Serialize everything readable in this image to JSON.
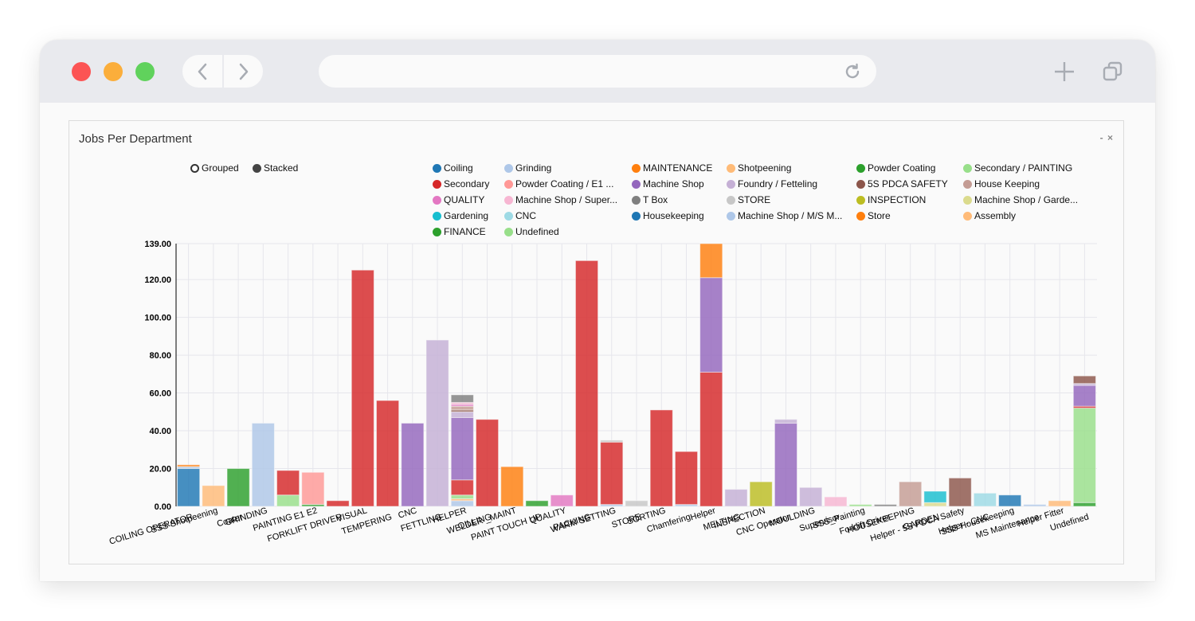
{
  "browser": {
    "url": ""
  },
  "panel": {
    "title": "Jobs Per Department",
    "minimize_label": "-",
    "close_label": "×"
  },
  "controls": {
    "grouped_label": "Grouped",
    "stacked_label": "Stacked",
    "selected": "Stacked"
  },
  "chart_data": {
    "type": "bar",
    "stacked": true,
    "title": "Jobs Per Department",
    "xlabel": "",
    "ylabel": "",
    "ylim": [
      0,
      139
    ],
    "yticks": [
      "0.00",
      "20.00",
      "40.00",
      "60.00",
      "80.00",
      "100.00",
      "120.00",
      "139.00"
    ],
    "ytick_values": [
      0,
      20,
      40,
      60,
      80,
      100,
      120,
      139
    ],
    "grid": true,
    "legend_position": "top-right",
    "categories": [
      "COILING OPERATOR",
      "SSS Shotpeening",
      "Coater",
      "GRINDING",
      "PAINTING",
      "E1 E2",
      "FORKLIFT DRIVER",
      "VISUAL",
      "TEMPERING",
      "CNC",
      "FETTLING",
      "HELPER",
      "OILLING",
      "WELDER _MAINT",
      "PAINT TOUCH UP",
      "QUALITY",
      "PACKING",
      "WARM SETTING",
      "STORE",
      "SORTING",
      "Chamfering",
      "Helper",
      "MELTING",
      "INSPECTION",
      "CNC Operator",
      "MOULDING",
      "Supervisor",
      "SSS_Painting",
      "Forklift Driver",
      "HOUSEKEEPING",
      "GARDEN",
      "Helper - 5S PDCA Safety",
      "Helper - CNC",
      "SSS Housekeeping",
      "MS Maintenance",
      "Helper Fitter",
      "Undefined"
    ],
    "series": [
      {
        "name": "Coiling",
        "color": "#1f77b4",
        "values": [
          20,
          0,
          0,
          0,
          0,
          0,
          0,
          0,
          0,
          0,
          0,
          0,
          0,
          0,
          0,
          0,
          0,
          0,
          0,
          0,
          0,
          0,
          0,
          0,
          0,
          0,
          0,
          0,
          0,
          0,
          0,
          0,
          0,
          6,
          0,
          0,
          0
        ]
      },
      {
        "name": "Grinding",
        "color": "#aec7e8",
        "values": [
          1,
          0,
          0,
          44,
          0,
          0,
          0,
          0,
          0,
          0,
          0,
          3,
          0,
          0,
          0,
          0,
          0,
          1,
          0,
          0,
          1,
          0,
          0,
          0,
          0,
          0,
          0,
          0,
          0,
          0,
          0,
          0,
          0,
          0,
          1,
          0,
          0
        ]
      },
      {
        "name": "MAINTENANCE",
        "color": "#ff7f0e",
        "values": [
          1,
          0,
          0,
          0,
          0,
          0,
          0,
          0,
          0,
          0,
          0,
          0,
          0,
          21,
          0,
          0,
          0,
          0,
          0,
          0,
          0,
          0,
          0,
          0,
          0,
          0,
          0,
          0,
          0,
          0,
          0,
          0,
          0,
          0,
          0,
          0,
          0
        ]
      },
      {
        "name": "Shotpeening",
        "color": "#ffbb78",
        "values": [
          0,
          11,
          0,
          0,
          0,
          0,
          0,
          0,
          0,
          0,
          0,
          1,
          0,
          0,
          0,
          0,
          0,
          0,
          0,
          0,
          0,
          0,
          0,
          0,
          0,
          0,
          0,
          0,
          0,
          0,
          0,
          0,
          0,
          0,
          0,
          3,
          0
        ]
      },
      {
        "name": "Powder Coating",
        "color": "#2ca02c",
        "values": [
          0,
          0,
          20,
          0,
          0,
          1,
          0,
          0,
          0,
          0,
          0,
          0,
          0,
          0,
          3,
          0,
          0,
          0,
          0,
          0,
          0,
          0,
          0,
          0,
          0,
          0,
          0,
          0,
          0,
          0,
          0,
          0,
          0,
          0,
          0,
          0,
          2
        ]
      },
      {
        "name": "Secondary / PAINTING",
        "color": "#98df8a",
        "values": [
          0,
          0,
          0,
          0,
          6,
          0,
          0,
          0,
          0,
          0,
          0,
          2,
          0,
          0,
          0,
          0,
          0,
          0,
          0,
          0,
          0,
          0,
          0,
          0,
          0,
          0,
          0,
          1,
          0,
          0,
          0,
          0,
          0,
          0,
          0,
          0,
          50
        ]
      },
      {
        "name": "Secondary",
        "color": "#d62728",
        "values": [
          0,
          0,
          0,
          0,
          13,
          0,
          3,
          125,
          56,
          0,
          0,
          8,
          46,
          0,
          0,
          0,
          130,
          33,
          0,
          51,
          28,
          71,
          0,
          0,
          0,
          0,
          0,
          0,
          0,
          0,
          0,
          0,
          0,
          0,
          0,
          0,
          1
        ]
      },
      {
        "name": "Powder Coating / E1 ...",
        "color": "#ff9896",
        "values": [
          0,
          0,
          0,
          0,
          0,
          17,
          0,
          0,
          0,
          0,
          0,
          0,
          0,
          0,
          0,
          0,
          0,
          0,
          0,
          0,
          0,
          0,
          0,
          0,
          0,
          0,
          0,
          0,
          0,
          0,
          0,
          0,
          0,
          0,
          0,
          0,
          0
        ]
      },
      {
        "name": "Machine Shop",
        "color": "#9467bd",
        "values": [
          0,
          0,
          0,
          0,
          0,
          0,
          0,
          0,
          0,
          44,
          0,
          33,
          0,
          0,
          0,
          0,
          0,
          0,
          0,
          0,
          0,
          50,
          0,
          0,
          44,
          0,
          0,
          0,
          0,
          0,
          0,
          0,
          0,
          0,
          0,
          0,
          11
        ]
      },
      {
        "name": "Foundry / Fetteling",
        "color": "#c5b0d5",
        "values": [
          0,
          0,
          0,
          0,
          0,
          0,
          0,
          0,
          0,
          0,
          88,
          3,
          0,
          0,
          0,
          0,
          0,
          0,
          0,
          0,
          0,
          0,
          9,
          0,
          2,
          10,
          0,
          0,
          0,
          0,
          0,
          0,
          0,
          0,
          0,
          0,
          1
        ]
      },
      {
        "name": "5S PDCA SAFETY",
        "color": "#8c564b",
        "values": [
          0,
          0,
          0,
          0,
          0,
          0,
          0,
          0,
          0,
          0,
          0,
          1,
          0,
          0,
          0,
          0,
          0,
          0,
          0,
          0,
          0,
          0,
          0,
          0,
          0,
          0,
          0,
          0,
          0,
          0,
          0,
          15,
          0,
          0,
          0,
          0,
          4
        ]
      },
      {
        "name": "House Keeping",
        "color": "#c49c94",
        "values": [
          0,
          0,
          0,
          0,
          0,
          0,
          0,
          0,
          0,
          0,
          0,
          2,
          0,
          0,
          0,
          0,
          0,
          0,
          0,
          0,
          0,
          0,
          0,
          0,
          0,
          0,
          0,
          0,
          0,
          13,
          0,
          0,
          0,
          0,
          0,
          0,
          0
        ]
      },
      {
        "name": "QUALITY",
        "color": "#e377c2",
        "values": [
          0,
          0,
          0,
          0,
          0,
          0,
          0,
          0,
          0,
          0,
          0,
          1,
          0,
          0,
          0,
          6,
          0,
          0,
          0,
          0,
          0,
          0,
          0,
          0,
          0,
          0,
          0,
          0,
          0,
          0,
          0,
          0,
          0,
          0,
          0,
          0,
          0
        ]
      },
      {
        "name": "Machine Shop / Super...",
        "color": "#f7b6d2",
        "values": [
          0,
          0,
          0,
          0,
          0,
          0,
          0,
          0,
          0,
          0,
          0,
          1,
          0,
          0,
          0,
          0,
          0,
          0,
          0,
          0,
          0,
          0,
          0,
          0,
          0,
          0,
          5,
          0,
          0,
          0,
          0,
          0,
          0,
          0,
          0,
          0,
          0
        ]
      },
      {
        "name": "T Box",
        "color": "#7f7f7f",
        "values": [
          0,
          0,
          0,
          0,
          0,
          0,
          0,
          0,
          0,
          0,
          0,
          4,
          0,
          0,
          0,
          0,
          0,
          0,
          0,
          0,
          0,
          0,
          0,
          0,
          0,
          0,
          0,
          0,
          1,
          0,
          0,
          0,
          0,
          0,
          0,
          0,
          0
        ]
      },
      {
        "name": "STORE",
        "color": "#c7c7c7",
        "values": [
          0,
          0,
          0,
          0,
          0,
          0,
          0,
          0,
          0,
          0,
          0,
          0,
          0,
          0,
          0,
          0,
          0,
          1,
          3,
          0,
          0,
          0,
          0,
          0,
          0,
          0,
          0,
          0,
          0,
          0,
          0,
          0,
          0,
          0,
          0,
          0,
          0
        ]
      },
      {
        "name": "INSPECTION",
        "color": "#bcbd22",
        "values": [
          0,
          0,
          0,
          0,
          0,
          0,
          0,
          0,
          0,
          0,
          0,
          0,
          0,
          0,
          0,
          0,
          0,
          0,
          0,
          0,
          0,
          0,
          0,
          13,
          0,
          0,
          0,
          0,
          0,
          0,
          0,
          0,
          0,
          0,
          0,
          0,
          0
        ]
      },
      {
        "name": "Machine Shop / Garde...",
        "color": "#dbdb8d",
        "values": [
          0,
          0,
          0,
          0,
          0,
          0,
          0,
          0,
          0,
          0,
          0,
          0,
          0,
          0,
          0,
          0,
          0,
          0,
          0,
          0,
          0,
          0,
          0,
          0,
          0,
          0,
          0,
          0,
          0,
          0,
          2,
          0,
          0,
          0,
          0,
          0,
          0
        ]
      },
      {
        "name": "Gardening",
        "color": "#17becf",
        "values": [
          0,
          0,
          0,
          0,
          0,
          0,
          0,
          0,
          0,
          0,
          0,
          0,
          0,
          0,
          0,
          0,
          0,
          0,
          0,
          0,
          0,
          0,
          0,
          0,
          0,
          0,
          0,
          0,
          0,
          0,
          6,
          0,
          0,
          0,
          0,
          0,
          0
        ]
      },
      {
        "name": "CNC",
        "color": "#9edae5",
        "values": [
          0,
          0,
          0,
          0,
          0,
          0,
          0,
          0,
          0,
          0,
          0,
          0,
          0,
          0,
          0,
          0,
          0,
          0,
          0,
          0,
          0,
          0,
          0,
          0,
          0,
          0,
          0,
          0,
          0,
          0,
          0,
          0,
          7,
          0,
          0,
          0,
          0
        ]
      },
      {
        "name": "Housekeeping",
        "color": "#1f77b4",
        "values": [
          0,
          0,
          0,
          0,
          0,
          0,
          0,
          0,
          0,
          0,
          0,
          0,
          0,
          0,
          0,
          0,
          0,
          0,
          0,
          0,
          0,
          0,
          0,
          0,
          0,
          0,
          0,
          0,
          0,
          0,
          0,
          0,
          0,
          0,
          0,
          0,
          0
        ]
      },
      {
        "name": "Machine Shop / M/S M...",
        "color": "#aec7e8",
        "values": [
          0,
          0,
          0,
          0,
          0,
          0,
          0,
          0,
          0,
          0,
          0,
          0,
          0,
          0,
          0,
          0,
          0,
          0,
          0,
          0,
          0,
          0,
          0,
          0,
          0,
          0,
          0,
          0,
          0,
          0,
          0,
          0,
          0,
          0,
          0,
          0,
          0
        ]
      },
      {
        "name": "Store",
        "color": "#ff7f0e",
        "values": [
          0,
          0,
          0,
          0,
          0,
          0,
          0,
          0,
          0,
          0,
          0,
          0,
          0,
          0,
          0,
          0,
          0,
          0,
          0,
          0,
          0,
          18,
          0,
          0,
          0,
          0,
          0,
          0,
          0,
          0,
          0,
          0,
          0,
          0,
          0,
          0,
          0
        ]
      },
      {
        "name": "Assembly",
        "color": "#ffbb78",
        "values": [
          0,
          0,
          0,
          0,
          0,
          0,
          0,
          0,
          0,
          0,
          0,
          0,
          0,
          0,
          0,
          0,
          0,
          0,
          0,
          0,
          0,
          0,
          0,
          0,
          0,
          0,
          0,
          0,
          0,
          0,
          0,
          0,
          0,
          0,
          0,
          0,
          0
        ]
      },
      {
        "name": "FINANCE",
        "color": "#2ca02c",
        "values": [
          0,
          0,
          0,
          0,
          0,
          0,
          0,
          0,
          0,
          0,
          0,
          0,
          0,
          0,
          0,
          0,
          0,
          0,
          0,
          0,
          0,
          0,
          0,
          0,
          0,
          0,
          0,
          0,
          0,
          0,
          0,
          0,
          0,
          0,
          0,
          0,
          0
        ]
      },
      {
        "name": "Undefined",
        "color": "#98df8a",
        "values": [
          0,
          0,
          0,
          0,
          0,
          0,
          0,
          0,
          0,
          0,
          0,
          0,
          0,
          0,
          0,
          0,
          0,
          0,
          0,
          0,
          0,
          0,
          0,
          0,
          0,
          0,
          0,
          0,
          0,
          0,
          0,
          0,
          0,
          0,
          0,
          0,
          0
        ]
      }
    ],
    "legend_columns": [
      [
        "Coiling",
        "Secondary",
        "QUALITY",
        "Gardening",
        "FINANCE"
      ],
      [
        "Grinding",
        "Powder Coating / E1 ...",
        "Machine Shop / Super...",
        "CNC",
        "Undefined"
      ],
      [
        "MAINTENANCE",
        "Machine Shop",
        "T Box",
        "Housekeeping"
      ],
      [
        "Shotpeening",
        "Foundry / Fetteling",
        "STORE",
        "Machine Shop / M/S M..."
      ],
      [
        "Powder Coating",
        "5S PDCA SAFETY",
        "INSPECTION",
        "Store"
      ],
      [
        "Secondary / PAINTING",
        "House Keeping",
        "Machine Shop / Garde...",
        "Assembly"
      ]
    ]
  }
}
